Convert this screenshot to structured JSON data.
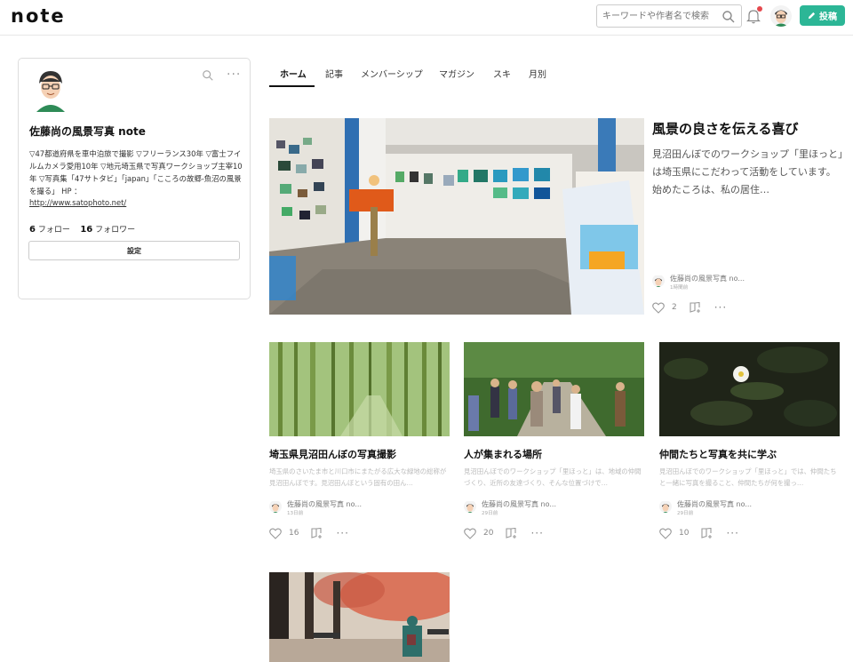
{
  "header": {
    "logo": "note",
    "search_placeholder": "キーワードや作者名で検索",
    "post_label": "投稿"
  },
  "profile": {
    "name": "佐藤尚の風景写真 note",
    "bio": "▽47都道府県を車中泊旅で撮影 ▽フリーランス30年 ▽富士フイルムカメラ愛用10年 ▽地元埼玉県で写真ワークショップ主宰10年 ▽写真集「47サトタビ」「japan」「こころの故郷-魚沼の風景を撮る」 HP ：",
    "url": "http://www.satophoto.net/",
    "following_count": "6",
    "following_label": "フォロー",
    "followers_count": "16",
    "followers_label": "フォロワー",
    "settings_label": "設定"
  },
  "tabs": [
    "ホーム",
    "記事",
    "メンバーシップ",
    "マガジン",
    "スキ",
    "月別"
  ],
  "featured": {
    "title": "風景の良さを伝える喜び",
    "description": "見沼田んぼでのワークショップ「里ほっと」は埼玉県にこだわって活動をしています。始めたころは、私の居住…",
    "author": "佐藤尚の風景写真 no...",
    "time": "1時間前",
    "likes": "2"
  },
  "cards": [
    {
      "title": "埼玉県見沼田んぼの写真撮影",
      "description": "埼玉県のさいたま市と川口市にまたがる広大な緑地の総称が見沼田んぼです。見沼田んぼという固有の田ん…",
      "author": "佐藤尚の風景写真 no...",
      "time": "13日前",
      "likes": "16"
    },
    {
      "title": "人が集まれる場所",
      "description": "見沼田んぼでのワークショップ「里ほっと」は、地域の仲間づくり、近所の友達づくり、そんな位置づけで…",
      "author": "佐藤尚の風景写真 no...",
      "time": "29日前",
      "likes": "20"
    },
    {
      "title": "仲間たちと写真を共に学ぶ",
      "description": "見沼田んぼでのワークショップ「里ほっと」では、仲間たちと一緒に写真を撮ること、仲間たちが何を撮っ…",
      "author": "佐藤尚の風景写真 no...",
      "time": "29日前",
      "likes": "10"
    }
  ],
  "colors": {
    "accent": "#2cb696",
    "notify": "#e5484d"
  },
  "icons": {
    "search": "search-icon",
    "bell": "bell-icon",
    "pen": "pen-icon",
    "more": "more-icon",
    "heart": "heart-icon",
    "magazine": "magazine-add-icon"
  }
}
